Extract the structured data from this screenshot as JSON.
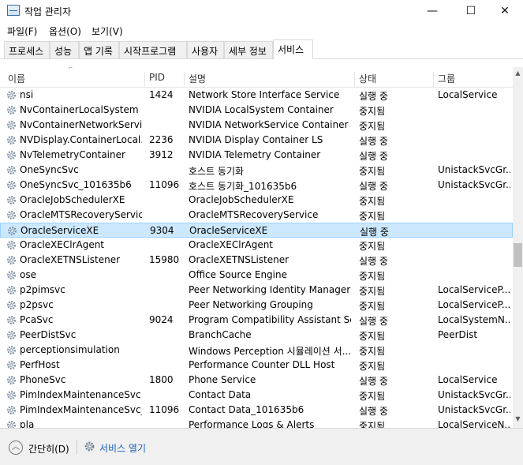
{
  "window": {
    "title": "작업 관리자",
    "minimize": "—",
    "maximize": "☐",
    "close": "✕"
  },
  "menu": [
    "파일(F)",
    "옵션(O)",
    "보기(V)"
  ],
  "tabs": [
    {
      "label": "프로세스"
    },
    {
      "label": "성능"
    },
    {
      "label": "앱 기록"
    },
    {
      "label": "시작프로그램"
    },
    {
      "label": "사용자"
    },
    {
      "label": "세부 정보"
    },
    {
      "label": "서비스",
      "active": true
    }
  ],
  "columns": {
    "name": "이름",
    "pid": "PID",
    "desc": "설명",
    "status": "상태",
    "group": "그룹"
  },
  "services": [
    {
      "name": "nsi",
      "pid": "1424",
      "desc": "Network Store Interface Service",
      "status": "실행 중",
      "group": "LocalService"
    },
    {
      "name": "NvContainerLocalSystem",
      "pid": "",
      "desc": "NVIDIA LocalSystem Container",
      "status": "중지됨",
      "group": ""
    },
    {
      "name": "NvContainerNetworkService",
      "pid": "",
      "desc": "NVIDIA NetworkService Container",
      "status": "중지됨",
      "group": ""
    },
    {
      "name": "NVDisplay.ContainerLocal...",
      "pid": "2236",
      "desc": "NVIDIA Display Container LS",
      "status": "실행 중",
      "group": ""
    },
    {
      "name": "NvTelemetryContainer",
      "pid": "3912",
      "desc": "NVIDIA Telemetry Container",
      "status": "실행 중",
      "group": ""
    },
    {
      "name": "OneSyncSvc",
      "pid": "",
      "desc": "호스트 동기화",
      "status": "중지됨",
      "group": "UnistackSvcGr..."
    },
    {
      "name": "OneSyncSvc_101635b6",
      "pid": "11096",
      "desc": "호스트 동기화_101635b6",
      "status": "실행 중",
      "group": "UnistackSvcGr..."
    },
    {
      "name": "OracleJobSchedulerXE",
      "pid": "",
      "desc": "OracleJobSchedulerXE",
      "status": "중지됨",
      "group": ""
    },
    {
      "name": "OracleMTSRecoveryService",
      "pid": "",
      "desc": "OracleMTSRecoveryService",
      "status": "중지됨",
      "group": ""
    },
    {
      "name": "OracleServiceXE",
      "pid": "9304",
      "desc": "OracleServiceXE",
      "status": "실행 중",
      "group": "",
      "selected": true
    },
    {
      "name": "OracleXEClrAgent",
      "pid": "",
      "desc": "OracleXEClrAgent",
      "status": "중지됨",
      "group": ""
    },
    {
      "name": "OracleXETNSListener",
      "pid": "15980",
      "desc": "OracleXETNSListener",
      "status": "실행 중",
      "group": ""
    },
    {
      "name": "ose",
      "pid": "",
      "desc": "Office  Source Engine",
      "status": "중지됨",
      "group": ""
    },
    {
      "name": "p2pimsvc",
      "pid": "",
      "desc": "Peer Networking Identity Manager",
      "status": "중지됨",
      "group": "LocalServiceP..."
    },
    {
      "name": "p2psvc",
      "pid": "",
      "desc": "Peer Networking Grouping",
      "status": "중지됨",
      "group": "LocalServiceP..."
    },
    {
      "name": "PcaSvc",
      "pid": "9024",
      "desc": "Program Compatibility Assistant Se...",
      "status": "실행 중",
      "group": "LocalSystemN..."
    },
    {
      "name": "PeerDistSvc",
      "pid": "",
      "desc": "BranchCache",
      "status": "중지됨",
      "group": "PeerDist"
    },
    {
      "name": "perceptionsimulation",
      "pid": "",
      "desc": "Windows Perception 시뮬레이션 서...",
      "status": "중지됨",
      "group": ""
    },
    {
      "name": "PerfHost",
      "pid": "",
      "desc": "Performance Counter DLL Host",
      "status": "중지됨",
      "group": ""
    },
    {
      "name": "PhoneSvc",
      "pid": "1800",
      "desc": "Phone Service",
      "status": "실행 중",
      "group": "LocalService"
    },
    {
      "name": "PimIndexMaintenanceSvc",
      "pid": "",
      "desc": "Contact Data",
      "status": "중지됨",
      "group": "UnistackSvcGr..."
    },
    {
      "name": "PimIndexMaintenanceSvc_...",
      "pid": "11096",
      "desc": "Contact Data_101635b6",
      "status": "실행 중",
      "group": "UnistackSvcGr..."
    },
    {
      "name": "pla",
      "pid": "",
      "desc": "Performance Logs & Alerts",
      "status": "중지됨",
      "group": "LocalServiceN..."
    }
  ],
  "footer": {
    "collapse_label": "간단히(D)",
    "open_services_label": "서비스 열기"
  },
  "colors": {
    "selected_bg": "#cce8ff",
    "selected_border": "#99d1ff",
    "link": "#1a5fb4"
  },
  "icons": {
    "service": "gear-icon",
    "collapse": "chevron-up-circle-icon",
    "open_services": "gear-icon",
    "app": "task-manager-icon"
  }
}
